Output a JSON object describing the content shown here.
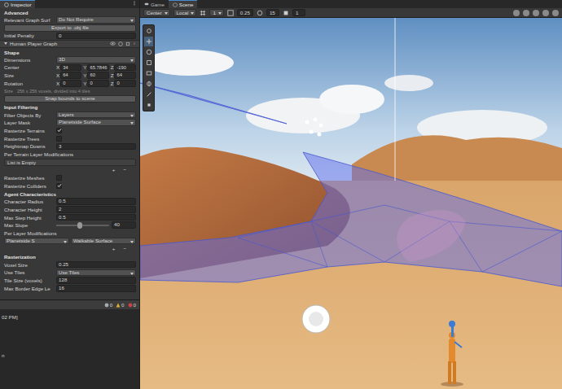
{
  "inspector": {
    "tab": "Inspector",
    "rows": [
      {
        "kind": "section",
        "label": "Advanced"
      },
      {
        "kind": "dropdown",
        "label": "Relevant Graph Surf",
        "value": "Do Not Require"
      },
      {
        "kind": "button",
        "label": "Export to .obj file"
      },
      {
        "kind": "field",
        "label": "Initial Penalty",
        "value": "0"
      },
      {
        "kind": "graph",
        "label": "Human Player Graph"
      },
      {
        "kind": "section",
        "label": "Shape"
      },
      {
        "kind": "dropdown",
        "label": "Dimensions",
        "value": "3D"
      },
      {
        "kind": "vector",
        "label": "Center",
        "axes": [
          {
            "axis": "X",
            "value": "34"
          },
          {
            "axis": "Y",
            "value": "65.7846"
          },
          {
            "axis": "Z",
            "value": "-190"
          }
        ]
      },
      {
        "kind": "vector",
        "label": "Size",
        "axes": [
          {
            "axis": "X",
            "value": "64"
          },
          {
            "axis": "Y",
            "value": "60"
          },
          {
            "axis": "Z",
            "value": "64"
          }
        ]
      },
      {
        "kind": "vector",
        "label": "Rotation",
        "axes": [
          {
            "axis": "X",
            "value": "0"
          },
          {
            "axis": "Y",
            "value": "0"
          },
          {
            "axis": "Z",
            "value": "0"
          }
        ]
      },
      {
        "kind": "info",
        "label": "Size",
        "value": "256 x 256 voxels, divided into 4 tiles"
      },
      {
        "kind": "button",
        "label": "Snap bounds to scene"
      },
      {
        "kind": "section",
        "label": "Input Filtering"
      },
      {
        "kind": "dropdown",
        "label": "Filter Objects By",
        "value": "Layers"
      },
      {
        "kind": "dropdown",
        "label": "Layer Mask",
        "value": "Planetside Surface"
      },
      {
        "kind": "checkbox",
        "label": "Rasterize Terrains",
        "checked": true
      },
      {
        "kind": "checkbox",
        "label": "Rasterize Trees",
        "checked": false
      },
      {
        "kind": "field",
        "label": "Heightmap Downs",
        "value": "3"
      },
      {
        "kind": "label",
        "label": "Per Terrain Layer Modifications"
      },
      {
        "kind": "list-empty",
        "label": "List is Empty"
      },
      {
        "kind": "list-buttons",
        "buttons": [
          "+",
          "−"
        ]
      },
      {
        "kind": "checkbox",
        "label": "Rasterize Meshes",
        "checked": false
      },
      {
        "kind": "checkbox",
        "label": "Rasterize Colliders",
        "checked": true
      },
      {
        "kind": "section",
        "label": "Agent Characteristics"
      },
      {
        "kind": "field",
        "label": "Character Radius",
        "value": "0.5"
      },
      {
        "kind": "field",
        "label": "Character Height",
        "value": "2"
      },
      {
        "kind": "field",
        "label": "Max Step Height",
        "value": "0.5"
      },
      {
        "kind": "slider",
        "label": "Max Slope",
        "value": "40",
        "level": 0.44
      },
      {
        "kind": "label",
        "label": "Per Layer Modifications"
      },
      {
        "kind": "layer-mod",
        "layer": "Planetside S",
        "value": "Walkable Surface"
      },
      {
        "kind": "list-buttons",
        "buttons": [
          "+",
          "−"
        ]
      },
      {
        "kind": "section",
        "label": "Rasterization"
      },
      {
        "kind": "field",
        "label": "Voxel Size",
        "value": "0.25"
      },
      {
        "kind": "dropdown",
        "label": "Use Tiles",
        "value": "Use Tiles"
      },
      {
        "kind": "field",
        "label": "Tile Size (voxels)",
        "value": "128"
      },
      {
        "kind": "field",
        "label": "Max Border Edge Le",
        "value": "16"
      }
    ]
  },
  "scene": {
    "tabs": [
      {
        "label": "Game",
        "selected": false
      },
      {
        "label": "Scene",
        "selected": true
      }
    ],
    "toolbar": {
      "pivot": "Center",
      "space": "Local",
      "grid": "1",
      "snap": "0.25",
      "rotate": "15",
      "scale": "1"
    }
  },
  "console": {
    "counts": [
      "0",
      "0",
      "0"
    ],
    "lines": [
      "02 PM]",
      "n"
    ]
  }
}
